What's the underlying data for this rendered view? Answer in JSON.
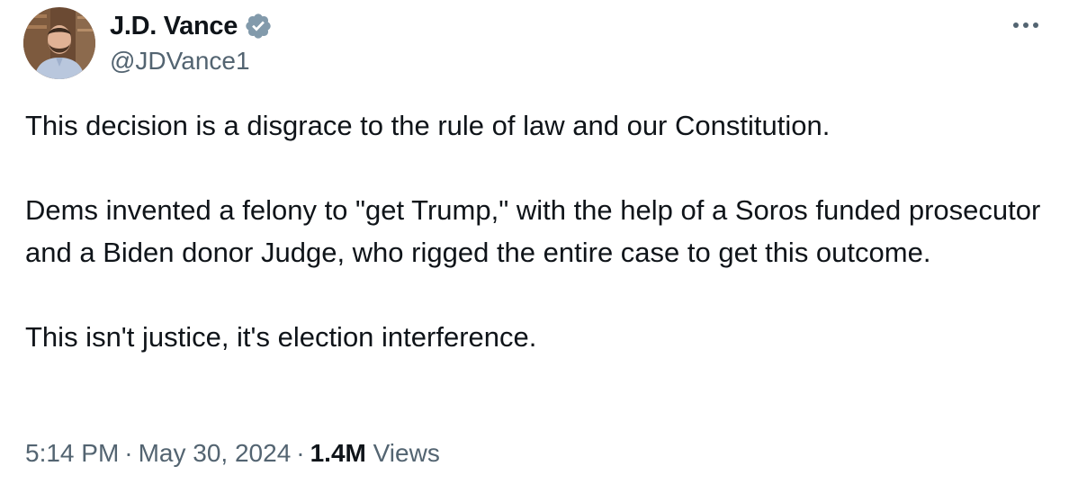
{
  "author": {
    "name": "J.D. Vance",
    "handle": "@JDVance1",
    "verified": true,
    "badge_color": "#829aab"
  },
  "tweet": {
    "paragraphs": [
      "This decision is a disgrace to the rule of law and our Constitution.",
      "Dems invented a felony to \"get Trump,\" with the help of a Soros funded prosecutor and a Biden donor Judge, who rigged the entire case to get this outcome.",
      "This isn't justice, it's election interference."
    ]
  },
  "meta": {
    "time": "5:14 PM",
    "date": "May 30, 2024",
    "separator": "·",
    "views_count": "1.4M",
    "views_label": "Views"
  },
  "icons": {
    "more": "more-horizontal-icon",
    "verified": "verified-badge-icon"
  },
  "colors": {
    "text": "#0f1419",
    "secondary": "#536471",
    "background": "#ffffff"
  }
}
